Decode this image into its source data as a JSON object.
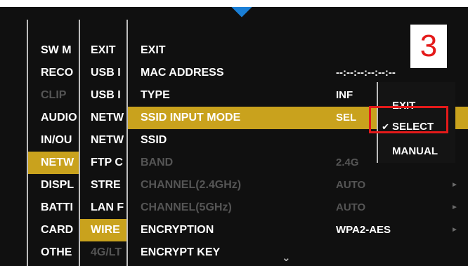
{
  "step_badge": "3",
  "col1": {
    "items": [
      {
        "label": "SW M",
        "dim": false
      },
      {
        "label": "RECO",
        "dim": false
      },
      {
        "label": "CLIP",
        "dim": true
      },
      {
        "label": "AUDIO",
        "dim": false
      },
      {
        "label": "IN/OU",
        "dim": false
      },
      {
        "label": "NETW",
        "dim": false,
        "selected": true
      },
      {
        "label": "DISPL",
        "dim": false
      },
      {
        "label": "BATTI",
        "dim": false
      },
      {
        "label": "CARD",
        "dim": false
      },
      {
        "label": "OTHE",
        "dim": false
      }
    ]
  },
  "col2": {
    "items": [
      {
        "label": "EXIT",
        "dim": false
      },
      {
        "label": "USB I",
        "dim": false
      },
      {
        "label": "USB I",
        "dim": false
      },
      {
        "label": "NETW",
        "dim": false
      },
      {
        "label": "NETW",
        "dim": false
      },
      {
        "label": "FTP C",
        "dim": false
      },
      {
        "label": "STRE",
        "dim": false
      },
      {
        "label": "LAN F",
        "dim": false
      },
      {
        "label": "WIRE",
        "dim": false,
        "selected": true
      },
      {
        "label": "4G/LT",
        "dim": true
      }
    ]
  },
  "col3": {
    "items": [
      {
        "label": "EXIT",
        "value": "",
        "dim": false
      },
      {
        "label": "MAC ADDRESS",
        "value": "--:--:--:--:--:--",
        "dim": false
      },
      {
        "label": "TYPE",
        "value": "INF",
        "dim": false
      },
      {
        "label": "SSID INPUT MODE",
        "value": "SEL",
        "dim": false,
        "selected": true
      },
      {
        "label": "SSID",
        "value": "",
        "dim": false
      },
      {
        "label": "BAND",
        "value": "2.4G",
        "dim": true
      },
      {
        "label": "CHANNEL(2.4GHz)",
        "value": "AUTO",
        "dim": true,
        "arrow": true
      },
      {
        "label": "CHANNEL(5GHz)",
        "value": "AUTO",
        "dim": true,
        "arrow": true
      },
      {
        "label": "ENCRYPTION",
        "value": "WPA2-AES",
        "dim": false,
        "arrow": true
      },
      {
        "label": "ENCRYPT KEY",
        "value": "",
        "dim": false
      }
    ]
  },
  "popup": {
    "options": [
      {
        "label": "EXIT",
        "checked": false
      },
      {
        "label": "SELECT",
        "checked": true
      },
      {
        "label": "MANUAL",
        "checked": false
      }
    ],
    "check_glyph": "✔"
  },
  "icons": {
    "submenu_arrow": "►",
    "scroll_down": "⌄"
  },
  "colors": {
    "highlight": "#c9a21d",
    "annotation": "#e41a1a",
    "pointer": "#1a7fd6"
  }
}
